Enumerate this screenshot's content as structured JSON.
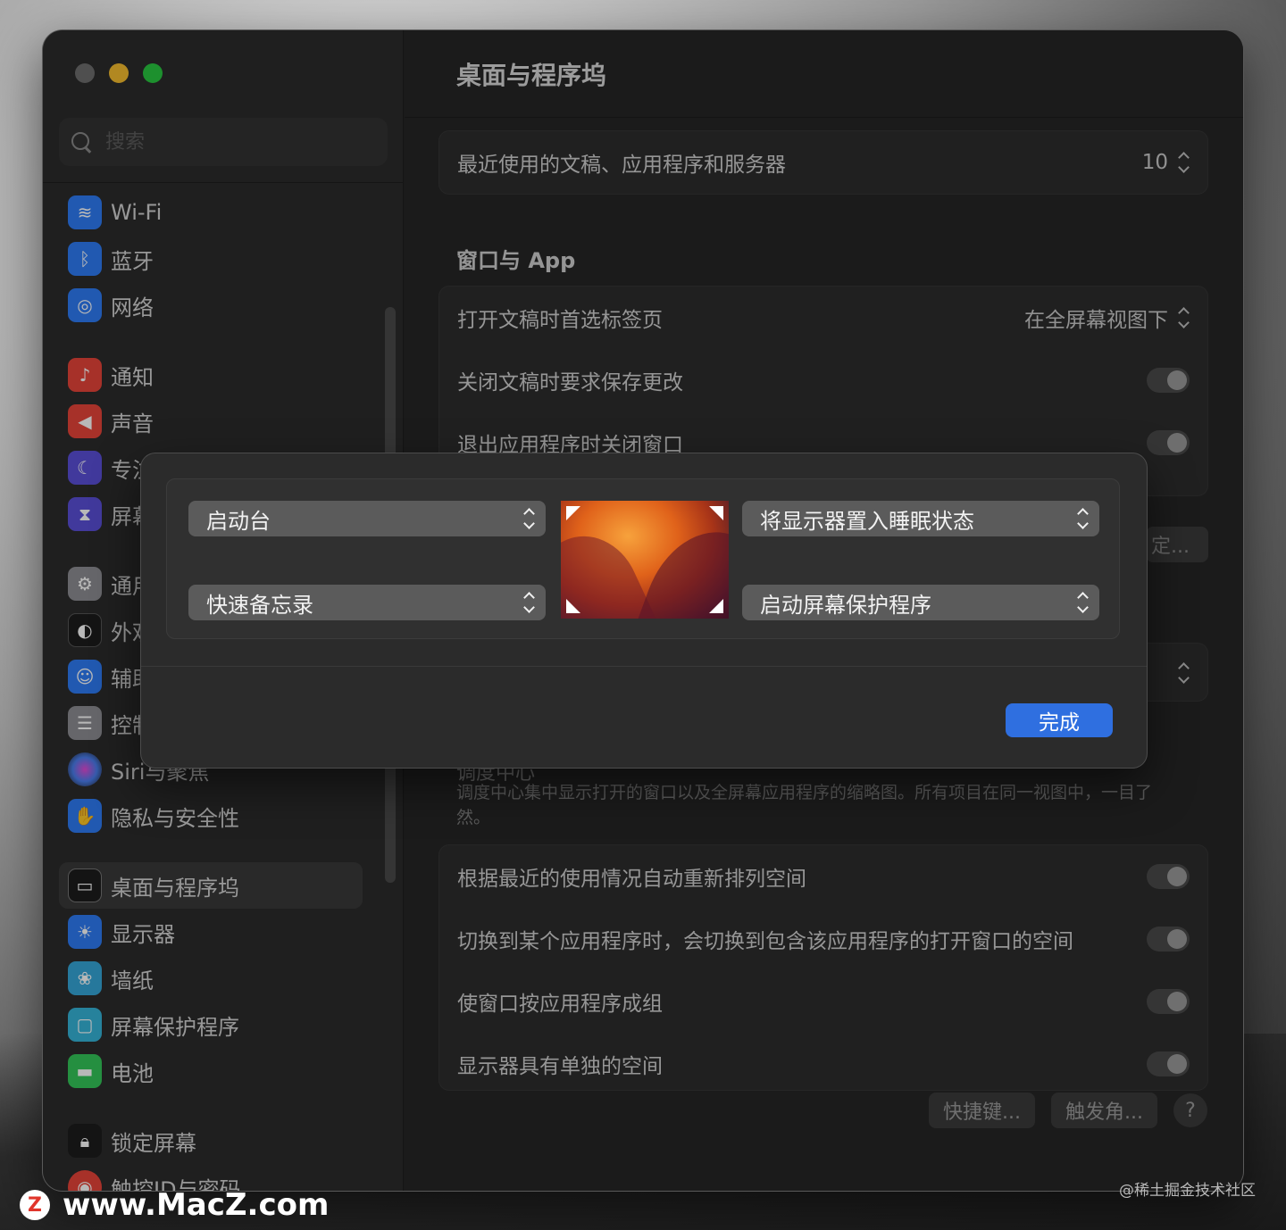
{
  "window_title": "桌面与程序坞",
  "search": {
    "placeholder": "搜索"
  },
  "sidebar": {
    "items": [
      {
        "label": "Wi-Fi",
        "icon": "wifi-icon",
        "color": "#2f7cf6"
      },
      {
        "label": "蓝牙",
        "icon": "bluetooth-icon",
        "color": "#2f7cf6"
      },
      {
        "label": "网络",
        "icon": "globe-icon",
        "color": "#2f7cf6"
      },
      {
        "label": "通知",
        "icon": "bell-icon",
        "color": "#e8443a"
      },
      {
        "label": "声音",
        "icon": "speaker-icon",
        "color": "#e8443a"
      },
      {
        "label": "专注模式",
        "icon": "moon-icon",
        "color": "#5b4fd8"
      },
      {
        "label": "屏幕使用时间",
        "icon": "hourglass-icon",
        "color": "#5b4fd8"
      },
      {
        "label": "通用",
        "icon": "gear-icon",
        "color": "#8e8e93"
      },
      {
        "label": "外观",
        "icon": "appearance-icon",
        "color": "#1c1c1c"
      },
      {
        "label": "辅助功能",
        "icon": "accessibility-icon",
        "color": "#2f7cf6"
      },
      {
        "label": "控制中心",
        "icon": "control-center-icon",
        "color": "#8e8e93"
      },
      {
        "label": "Siri与聚焦",
        "icon": "siri-icon",
        "color": "#b04bd8"
      },
      {
        "label": "隐私与安全性",
        "icon": "hand-icon",
        "color": "#2f7cf6"
      },
      {
        "label": "桌面与程序坞",
        "icon": "dock-icon",
        "color": "#1c1c1c"
      },
      {
        "label": "显示器",
        "icon": "sun-icon",
        "color": "#2f7cf6"
      },
      {
        "label": "墙纸",
        "icon": "wallpaper-icon",
        "color": "#35a7d8"
      },
      {
        "label": "屏幕保护程序",
        "icon": "screensaver-icon",
        "color": "#35b5d8"
      },
      {
        "label": "电池",
        "icon": "battery-icon",
        "color": "#34c759"
      },
      {
        "label": "锁定屏幕",
        "icon": "lock-icon",
        "color": "#1c1c1c"
      },
      {
        "label": "触控ID与密码",
        "icon": "fingerprint-icon",
        "color": "#e8443a"
      }
    ]
  },
  "main": {
    "recent_items": {
      "label": "最近使用的文稿、应用程序和服务器",
      "value": "10"
    },
    "windows_section": "窗口与 App",
    "prefer_tabs": {
      "label": "打开文稿时首选标签页",
      "value": "在全屏幕视图下"
    },
    "ask_keep_changes": {
      "label": "关闭文稿时要求保存更改"
    },
    "close_windows": {
      "label": "退出应用程序时关闭窗口"
    },
    "partial_button": "定...",
    "mission_control_head": "调度中心",
    "mission_control_desc": "调度中心集中显示打开的窗口以及全屏幕应用程序的缩略图。所有项目在同一视图中，一目了然。",
    "spaces": [
      {
        "label": "根据最近的使用情况自动重新排列空间"
      },
      {
        "label": "切换到某个应用程序时，会切换到包含该应用程序的打开窗口的空间"
      },
      {
        "label": "使窗口按应用程序成组"
      },
      {
        "label": "显示器具有单独的空间"
      }
    ],
    "shortcuts_button": "快捷键...",
    "hot_corners_button": "触发角...",
    "help_button": "?"
  },
  "hot_corners_sheet": {
    "top_left": "启动台",
    "bottom_left": "快速备忘录",
    "top_right": "将显示器置入睡眠状态",
    "bottom_right": "启动屏幕保护程序",
    "done": "完成"
  },
  "watermark_left": "www.MacZ.com",
  "watermark_logo": "Z",
  "watermark_right": "@稀土掘金技术社区"
}
